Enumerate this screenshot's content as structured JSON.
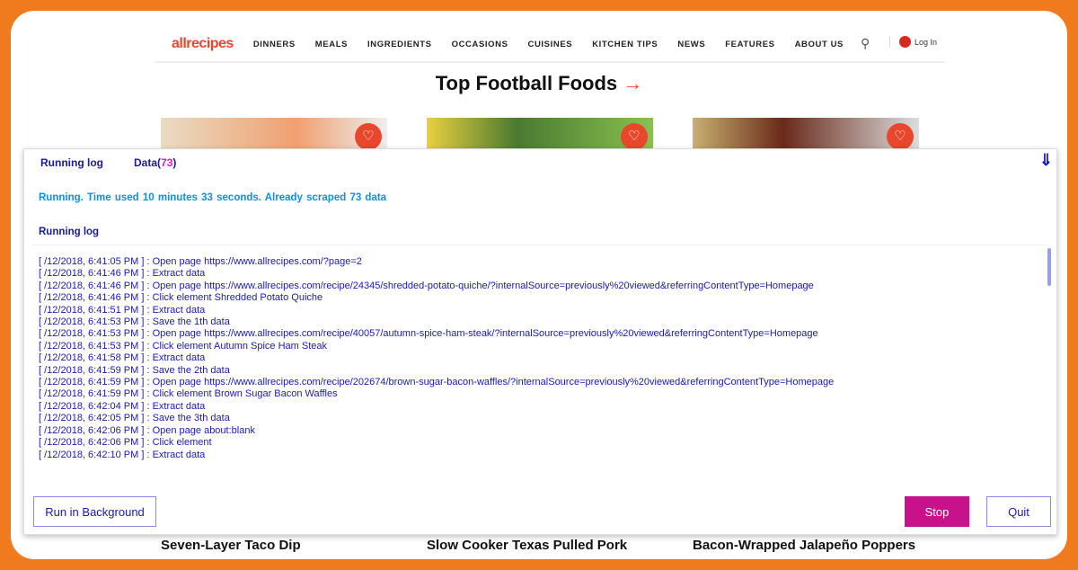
{
  "site": {
    "logo": "allrecipes",
    "nav": [
      "DINNERS",
      "MEALS",
      "INGREDIENTS",
      "OCCASIONS",
      "CUISINES",
      "KITCHEN TIPS",
      "NEWS",
      "FEATURES",
      "ABOUT US"
    ],
    "login": "Log In",
    "section_title": "Top Football Foods",
    "section_arrow": "→",
    "cards": [
      {
        "title": "Seven-Layer Taco Dip"
      },
      {
        "title": "Slow Cooker Texas Pulled Pork"
      },
      {
        "title": "Bacon-Wrapped Jalapeño Poppers"
      }
    ]
  },
  "dialog": {
    "tab_log": "Running log",
    "tab_data": "Data(",
    "tab_data_count": "73",
    "tab_data_close": ")",
    "status": "Running.   Time used 10 minutes 33 seconds.   Already scraped 73 data",
    "log_heading": "Running log",
    "log": [
      "[ /12/2018, 6:41:05 PM ] : Open page https://www.allrecipes.com/?page=2",
      "[ /12/2018, 6:41:46 PM ] : Extract data",
      "[ /12/2018, 6:41:46 PM ] : Open page https://www.allrecipes.com/recipe/24345/shredded-potato-quiche/?internalSource=previously%20viewed&referringContentType=Homepage",
      "[ /12/2018, 6:41:46 PM ] : Click element Shredded Potato Quiche",
      "[ /12/2018, 6:41:51 PM ] : Extract data",
      "[ /12/2018, 6:41:53 PM ] : Save the 1th data",
      "[ /12/2018, 6:41:53 PM ] : Open page https://www.allrecipes.com/recipe/40057/autumn-spice-ham-steak/?internalSource=previously%20viewed&referringContentType=Homepage",
      "[ /12/2018, 6:41:53 PM ] : Click element Autumn Spice Ham Steak",
      "[ /12/2018, 6:41:58 PM ] : Extract data",
      "[ /12/2018, 6:41:59 PM ] : Save the 2th data",
      "[ /12/2018, 6:41:59 PM ] : Open page https://www.allrecipes.com/recipe/202674/brown-sugar-bacon-waffles/?internalSource=previously%20viewed&referringContentType=Homepage",
      "[ /12/2018, 6:41:59 PM ] : Click element Brown Sugar Bacon Waffles",
      "[ /12/2018, 6:42:04 PM ] : Extract data",
      "[ /12/2018, 6:42:05 PM ] : Save the 3th data",
      "[ /12/2018, 6:42:06 PM ] : Open page about:blank",
      "[ /12/2018, 6:42:06 PM ] : Click element",
      "[ /12/2018, 6:42:10 PM ] : Extract data"
    ],
    "btn_background": "Run in Background",
    "btn_stop": "Stop",
    "btn_quit": "Quit"
  },
  "colors": {
    "brand": "#e8472c",
    "frame": "#f07a1e",
    "stop": "#c8128c",
    "log_text": "#1a1ab0",
    "status": "#0a90e8"
  }
}
